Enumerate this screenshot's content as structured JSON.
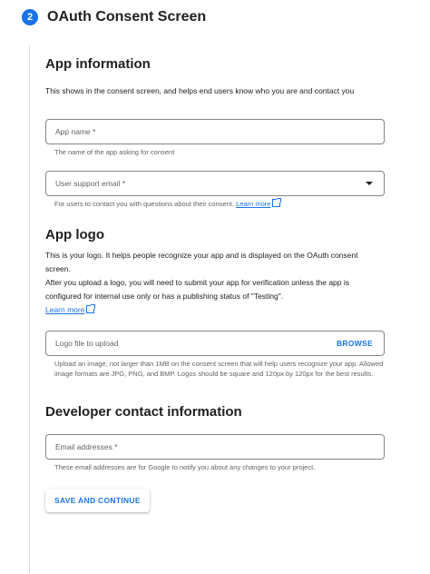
{
  "step": {
    "number": "2",
    "title": "OAuth Consent Screen"
  },
  "app_info": {
    "title": "App information",
    "description": "This shows in the consent screen, and helps end users know who you are and contact you",
    "app_name": {
      "placeholder": "App name *",
      "hint": "The name of the app asking for consent"
    },
    "support_email": {
      "placeholder": "User support email *",
      "hint": "For users to contact you with questions about their consent.",
      "learn_more": "Learn more"
    }
  },
  "app_logo": {
    "title": "App logo",
    "description_1": "This is your logo. It helps people recognize your app and is displayed on the OAuth consent screen.",
    "description_2": "After you upload a logo, you will need to submit your app for verification unless the app is configured for internal use only or has a publishing status of \"Testing\".",
    "learn_more": "Learn more",
    "file": {
      "placeholder": "Logo file to upload",
      "browse": "BROWSE"
    },
    "hint": "Upload an image, not larger than 1MB on the consent screen that will help users recognize your app. Allowed image formats are JPG, PNG, and BMP. Logos should be square and 120px by 120px for the best results."
  },
  "developer": {
    "title": "Developer contact information",
    "email": {
      "placeholder": "Email addresses *",
      "hint": "These email addresses are for Google to notify you about any changes to your project."
    }
  },
  "actions": {
    "save_continue": "SAVE AND CONTINUE"
  }
}
